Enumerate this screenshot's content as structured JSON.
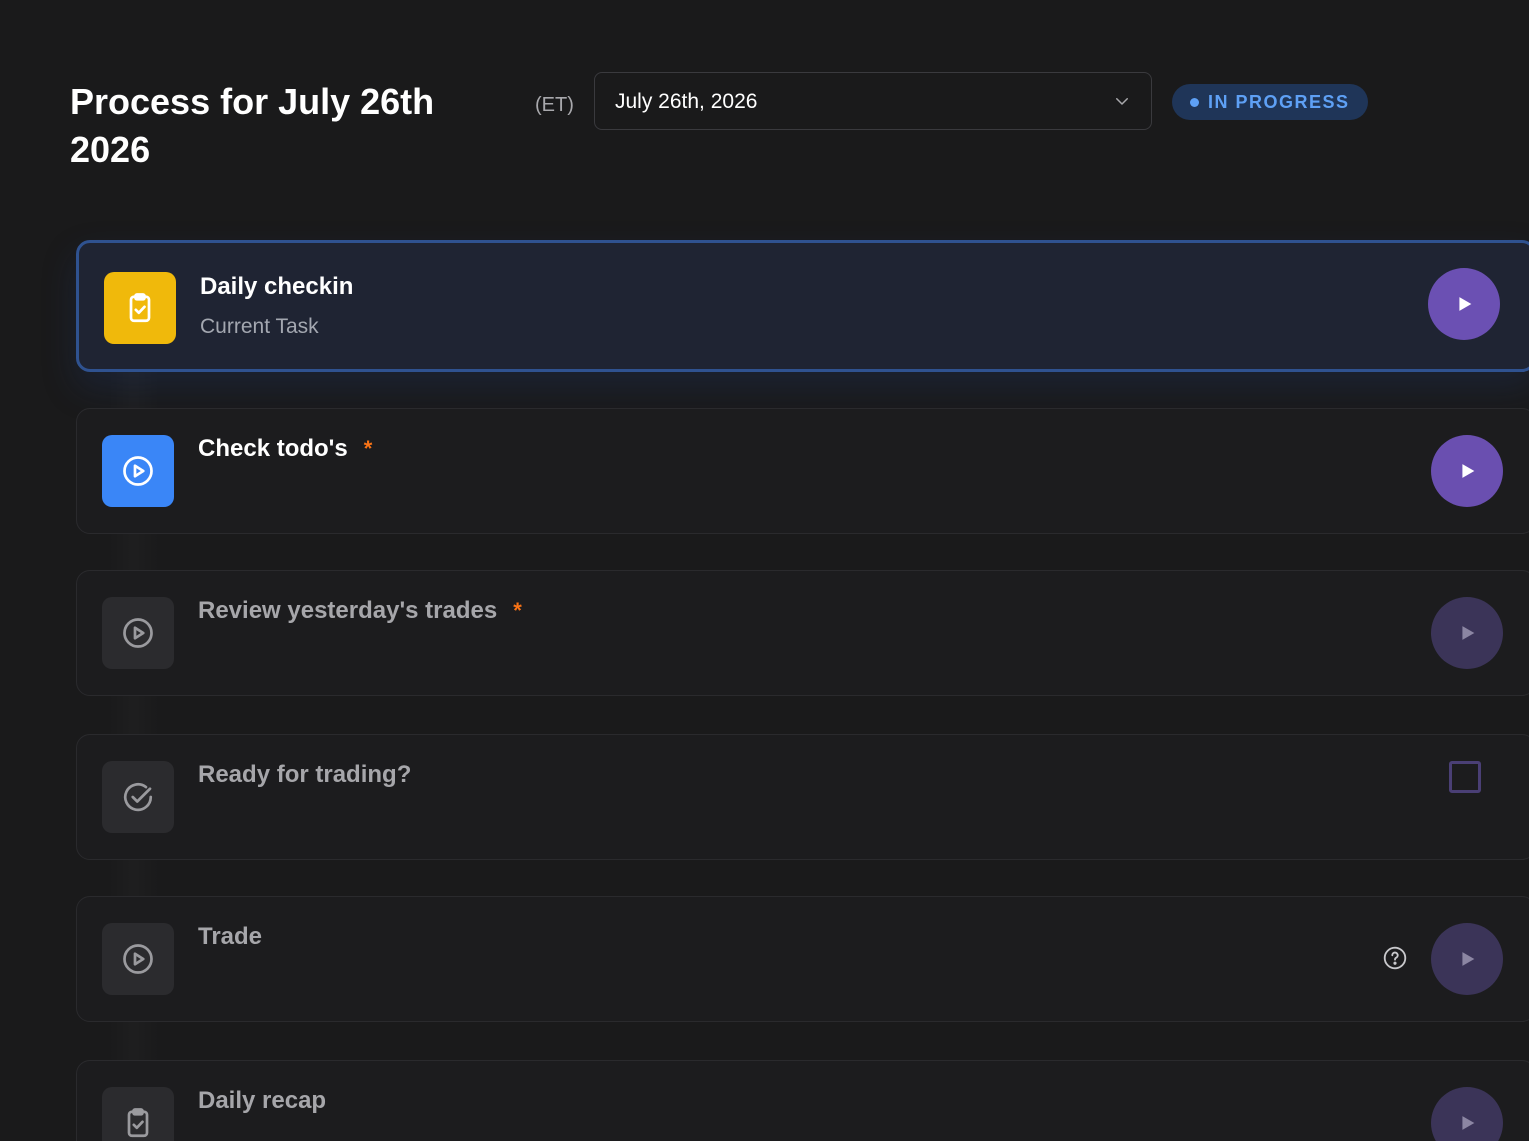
{
  "header": {
    "title": "Process for July 26th 2026",
    "timezone": "(ET)",
    "date_value": "July 26th, 2026",
    "status": "IN PROGRESS"
  },
  "tasks": [
    {
      "name": "Daily checkin",
      "subtitle": "Current Task",
      "icon": "clipboard-check-icon",
      "required": false,
      "action": "play",
      "state": "current"
    },
    {
      "name": "Check todo's",
      "icon": "play-circle-icon",
      "required": true,
      "required_mark": "*",
      "action": "play",
      "state": "next"
    },
    {
      "name": "Review yesterday's trades",
      "icon": "play-circle-icon",
      "required": true,
      "required_mark": "*",
      "action": "play",
      "state": "pending"
    },
    {
      "name": "Ready for trading?",
      "icon": "check-circle-icon",
      "required": false,
      "action": "checkbox",
      "state": "pending"
    },
    {
      "name": "Trade",
      "icon": "play-circle-icon",
      "required": false,
      "action": "play",
      "help": true,
      "state": "pending"
    },
    {
      "name": "Daily recap",
      "icon": "clipboard-check-icon",
      "required": false,
      "action": "play",
      "state": "pending"
    }
  ],
  "colors": {
    "accent_purple": "#6b50b3",
    "accent_blue": "#3a86f7",
    "accent_yellow": "#f0b90b",
    "required_orange": "#f97316",
    "status_blue": "#5ea0f5"
  }
}
